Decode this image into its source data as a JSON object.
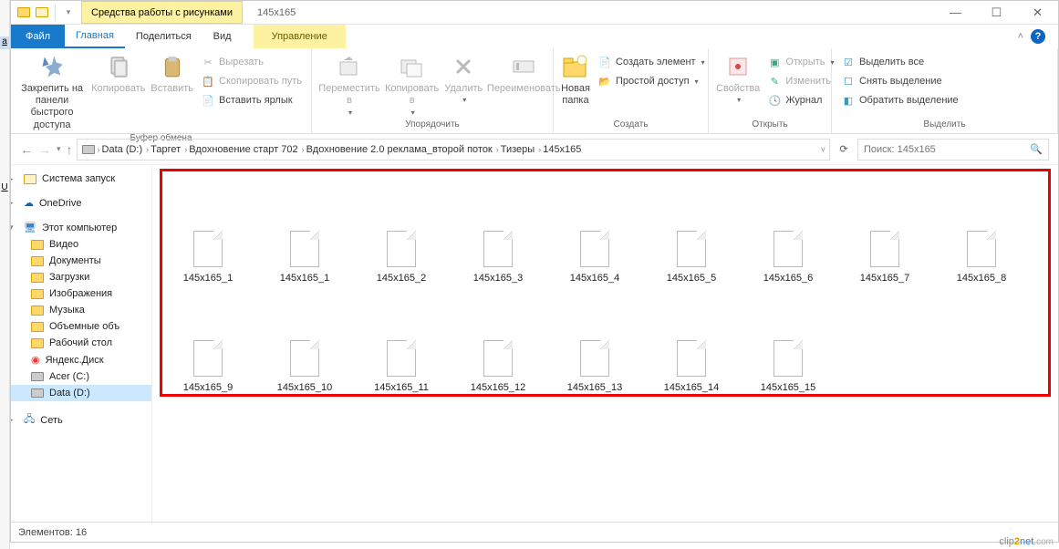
{
  "titlebar": {
    "contextual": "Средства работы с рисунками",
    "title": "145x165",
    "win": {
      "min": "—",
      "max": "☐",
      "close": "✕"
    }
  },
  "tabs": {
    "file": "Файл",
    "items": [
      "Главная",
      "Поделиться",
      "Вид"
    ],
    "context": "Управление"
  },
  "ribbon": {
    "clipboard": {
      "pin": "Закрепить на панели\nбыстрого доступа",
      "copy": "Копировать",
      "paste": "Вставить",
      "cut": "Вырезать",
      "copypath": "Скопировать путь",
      "pastelink": "Вставить ярлык",
      "label": "Буфер обмена"
    },
    "organize": {
      "moveto": "Переместить\nв",
      "copyto": "Копировать\nв",
      "delete": "Удалить",
      "rename": "Переименовать",
      "label": "Упорядочить"
    },
    "new": {
      "newfolder": "Новая\nпапка",
      "newitem": "Создать элемент",
      "easyaccess": "Простой доступ",
      "label": "Создать"
    },
    "open": {
      "properties": "Свойства",
      "open": "Открыть",
      "edit": "Изменить",
      "history": "Журнал",
      "label": "Открыть"
    },
    "select": {
      "selectall": "Выделить все",
      "selectnone": "Снять выделение",
      "invert": "Обратить выделение",
      "label": "Выделить"
    }
  },
  "nav": {
    "crumbs": [
      "Data (D:)",
      "Таргет",
      "Вдохновение старт 702",
      "Вдохновение 2.0 реклама_второй поток",
      "Тизеры",
      "145x165"
    ],
    "search_placeholder": "Поиск: 145x165"
  },
  "sidebar": {
    "quick": "Система запуск",
    "onedrive": "OneDrive",
    "thispc": "Этот компьютер",
    "items": [
      "Видео",
      "Документы",
      "Загрузки",
      "Изображения",
      "Музыка",
      "Объемные объ",
      "Рабочий стол",
      "Яндекс.Диск",
      "Acer (C:)",
      "Data (D:)"
    ],
    "network": "Сеть"
  },
  "files": [
    "145x165_1",
    "145x165_1",
    "145x165_2",
    "145x165_3",
    "145x165_4",
    "145x165_5",
    "145x165_6",
    "145x165_7",
    "145x165_8",
    "145x165_9",
    "145x165_10",
    "145x165_11",
    "145x165_12",
    "145x165_13",
    "145x165_14",
    "145x165_15"
  ],
  "status": {
    "count": "Элементов: 16"
  },
  "leftedge": {
    "a": "a",
    "u": "U"
  },
  "watermark": {
    "a": "clip",
    "b": "2",
    "c": "net",
    "d": ".com"
  }
}
